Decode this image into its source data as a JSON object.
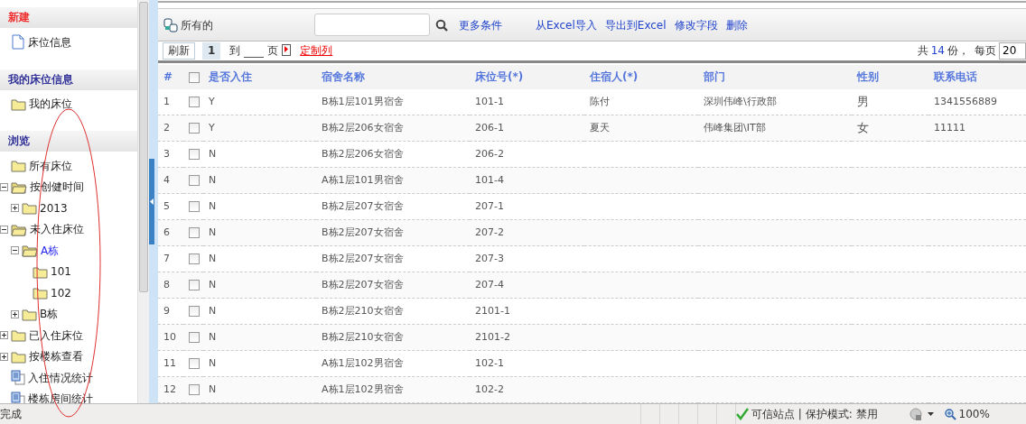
{
  "sidebar": {
    "sections": [
      {
        "title": "新建",
        "kind": "new",
        "items": [
          {
            "label": "床位信息",
            "kind": "doc",
            "selected": false
          }
        ]
      },
      {
        "title": "我的床位信息",
        "kind": "normal",
        "items": [
          {
            "label": "我的床位",
            "kind": "folder",
            "selected": false
          }
        ]
      },
      {
        "title": "浏览",
        "kind": "normal",
        "items": [
          {
            "label": "所有床位",
            "kind": "folder",
            "selected": false
          },
          {
            "label": "按创健时间",
            "kind": "folder",
            "selected": false,
            "expanded": true,
            "children": [
              {
                "label": "2013",
                "kind": "folder",
                "selected": false,
                "expanded": false
              }
            ]
          },
          {
            "label": "未入住床位",
            "kind": "folder",
            "selected": false,
            "expanded": true,
            "children": [
              {
                "label": "A栋",
                "kind": "folder",
                "selected": true,
                "expanded": true,
                "children": [
                  {
                    "label": "101",
                    "kind": "folder",
                    "selected": false
                  },
                  {
                    "label": "102",
                    "kind": "folder",
                    "selected": false
                  }
                ]
              },
              {
                "label": "B栋",
                "kind": "folder",
                "selected": false,
                "expanded": false
              }
            ]
          },
          {
            "label": "已入住床位",
            "kind": "folder",
            "selected": false,
            "expanded": false
          },
          {
            "label": "按楼栋查看",
            "kind": "folder",
            "selected": false,
            "expanded": false
          },
          {
            "label": "入住情况统计",
            "kind": "report",
            "selected": false
          },
          {
            "label": "楼栋房间统计",
            "kind": "report",
            "selected": false
          }
        ]
      }
    ]
  },
  "toolbar": {
    "view": "所有的",
    "links": [
      "更多条件",
      "从Excel导入",
      "导出到Excel",
      "修改字段",
      "删除"
    ]
  },
  "pager": {
    "refresh": "刷新",
    "page": "1",
    "goto": "到",
    "page_unit": "页",
    "customize": "定制列",
    "total_prefix": "共",
    "total": "14",
    "total_suffix": "份，",
    "per_page_label": "每页",
    "per_page": "20"
  },
  "table": {
    "select_all": {
      "checked": false
    },
    "columns": [
      "#",
      "是否入住",
      "宿舍名称",
      "床位号(*)",
      "住宿人(*)",
      "部门",
      "性别",
      "联系电话"
    ],
    "rows": [
      {
        "num": "1",
        "checked": false,
        "occupied": "Y",
        "dorm": "B栋1层101男宿舍",
        "bed": "101-1",
        "occupant": "陈付",
        "dept": "深圳伟峰\\行政部",
        "gender": "男",
        "phone": "1341556889"
      },
      {
        "num": "2",
        "checked": false,
        "occupied": "Y",
        "dorm": "B栋2层206女宿舍",
        "bed": "206-1",
        "occupant": "夏天",
        "dept": "伟峰集团\\IT部",
        "gender": "女",
        "phone": "11111"
      },
      {
        "num": "3",
        "checked": false,
        "occupied": "N",
        "dorm": "B栋2层206女宿舍",
        "bed": "206-2"
      },
      {
        "num": "4",
        "checked": false,
        "occupied": "N",
        "dorm": "A栋1层101男宿舍",
        "bed": "101-4"
      },
      {
        "num": "5",
        "checked": false,
        "occupied": "N",
        "dorm": "B栋2层207女宿舍",
        "bed": "207-1"
      },
      {
        "num": "6",
        "checked": false,
        "occupied": "N",
        "dorm": "B栋2层207女宿舍",
        "bed": "207-2"
      },
      {
        "num": "7",
        "checked": false,
        "occupied": "N",
        "dorm": "B栋2层207女宿舍",
        "bed": "207-3"
      },
      {
        "num": "8",
        "checked": false,
        "occupied": "N",
        "dorm": "B栋2层207女宿舍",
        "bed": "207-4"
      },
      {
        "num": "9",
        "checked": false,
        "occupied": "N",
        "dorm": "B栋2层210女宿舍",
        "bed": "2101-1"
      },
      {
        "num": "10",
        "checked": false,
        "occupied": "N",
        "dorm": "B栋2层210女宿舍",
        "bed": "2101-2"
      },
      {
        "num": "11",
        "checked": false,
        "occupied": "N",
        "dorm": "A栋1层102男宿舍",
        "bed": "102-1"
      },
      {
        "num": "12",
        "checked": false,
        "occupied": "N",
        "dorm": "A栋1层102男宿舍",
        "bed": "102-2"
      }
    ]
  },
  "status_bar": {
    "text": "完成",
    "zone": "可信站点 | 保护模式: 禁用",
    "zoom": "100%"
  },
  "annotation": {
    "kind": "ellipse"
  }
}
